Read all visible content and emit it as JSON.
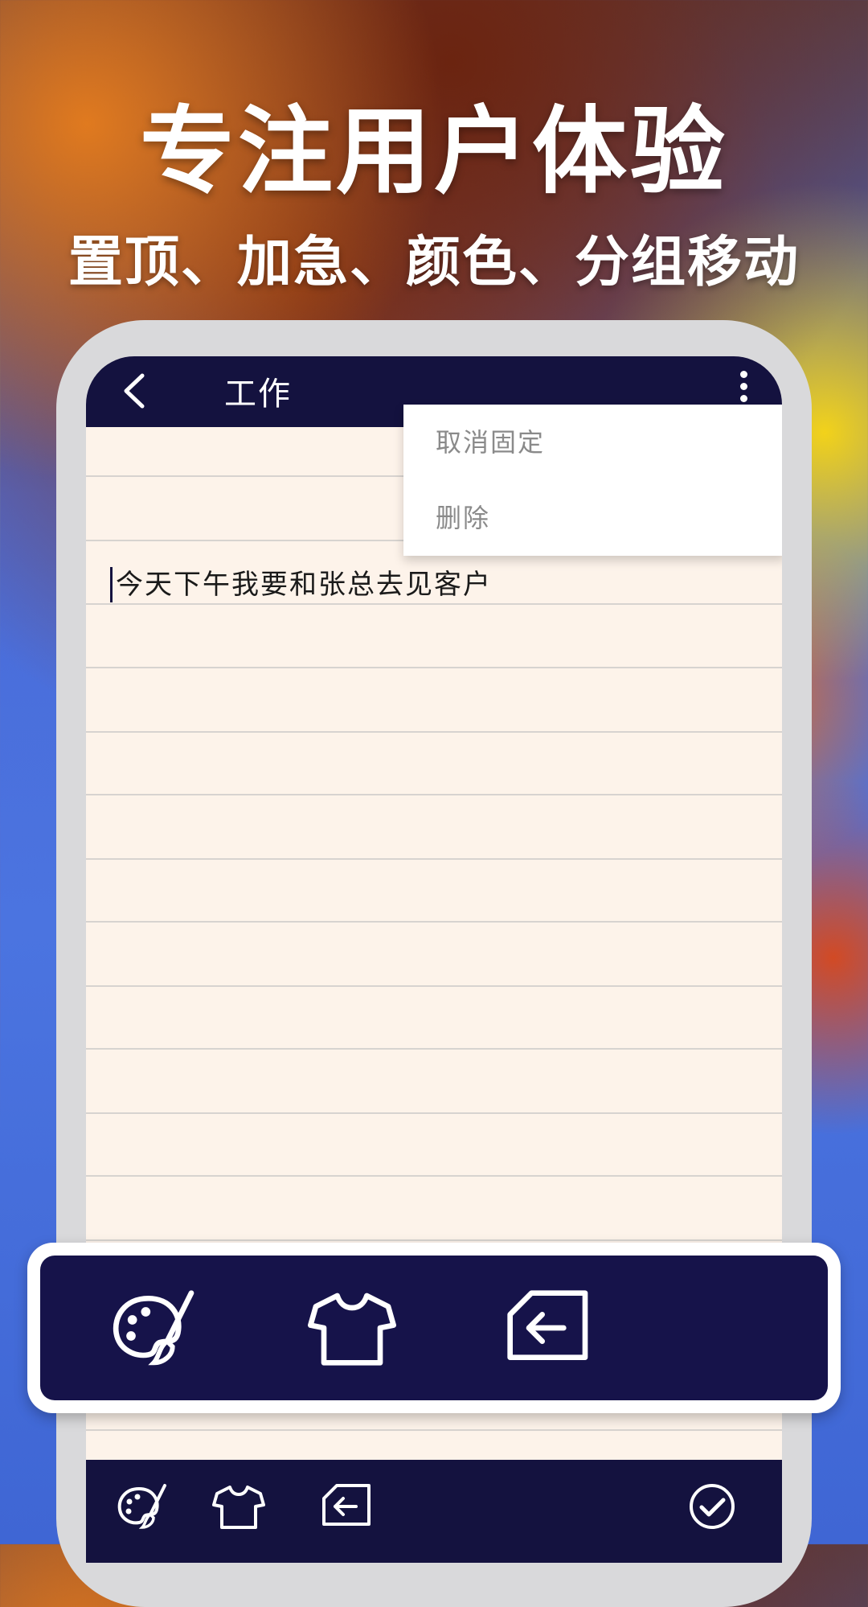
{
  "promo": {
    "headline": "专注用户体验",
    "subheadline": "置顶、加急、颜色、分组移动"
  },
  "appbar": {
    "title": "工作",
    "back_icon": "chevron-left-icon",
    "more_icon": "more-vert-icon"
  },
  "menu": {
    "items": [
      {
        "label": "取消固定"
      },
      {
        "label": "删除"
      }
    ]
  },
  "note": {
    "text": "今天下午我要和张总去见客户"
  },
  "toolbar": {
    "icons": [
      "palette-icon",
      "shirt-icon",
      "move-group-icon",
      "confirm-check-icon"
    ]
  },
  "colors": {
    "appbar": "#14123f",
    "paper": "#fdf3ea",
    "menu_text": "#8a8a8a",
    "frame": "#d9d9db"
  }
}
